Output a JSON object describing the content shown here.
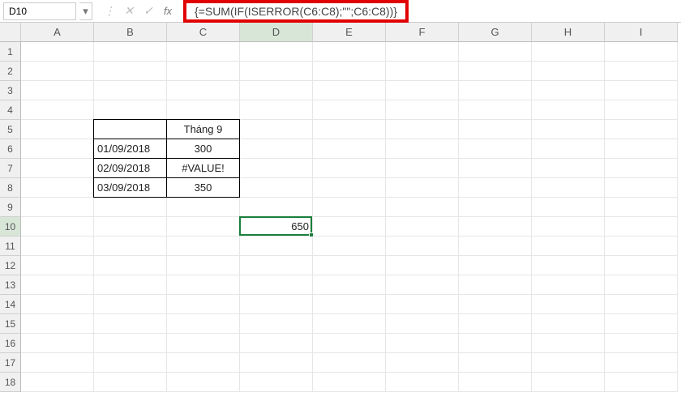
{
  "nameBox": "D10",
  "formula": "{=SUM(IF(ISERROR(C6:C8);\"\";C6:C8))}",
  "columns": [
    "A",
    "B",
    "C",
    "D",
    "E",
    "F",
    "G",
    "H",
    "I"
  ],
  "rows": [
    "1",
    "2",
    "3",
    "4",
    "5",
    "6",
    "7",
    "8",
    "9",
    "10",
    "11",
    "12",
    "13",
    "14",
    "15",
    "16",
    "17",
    "18"
  ],
  "activeCol": 4,
  "activeRow": 10,
  "cells": {
    "C5": "Tháng 9",
    "B6": "01/09/2018",
    "C6": "300",
    "B7": "02/09/2018",
    "C7": "#VALUE!",
    "B8": "03/09/2018",
    "C8": "350",
    "D10": "650"
  },
  "icons": {
    "dropdown": "▾",
    "cancel": "✕",
    "enter": "✓",
    "fx": "fx",
    "ellipsis": "⋮"
  }
}
